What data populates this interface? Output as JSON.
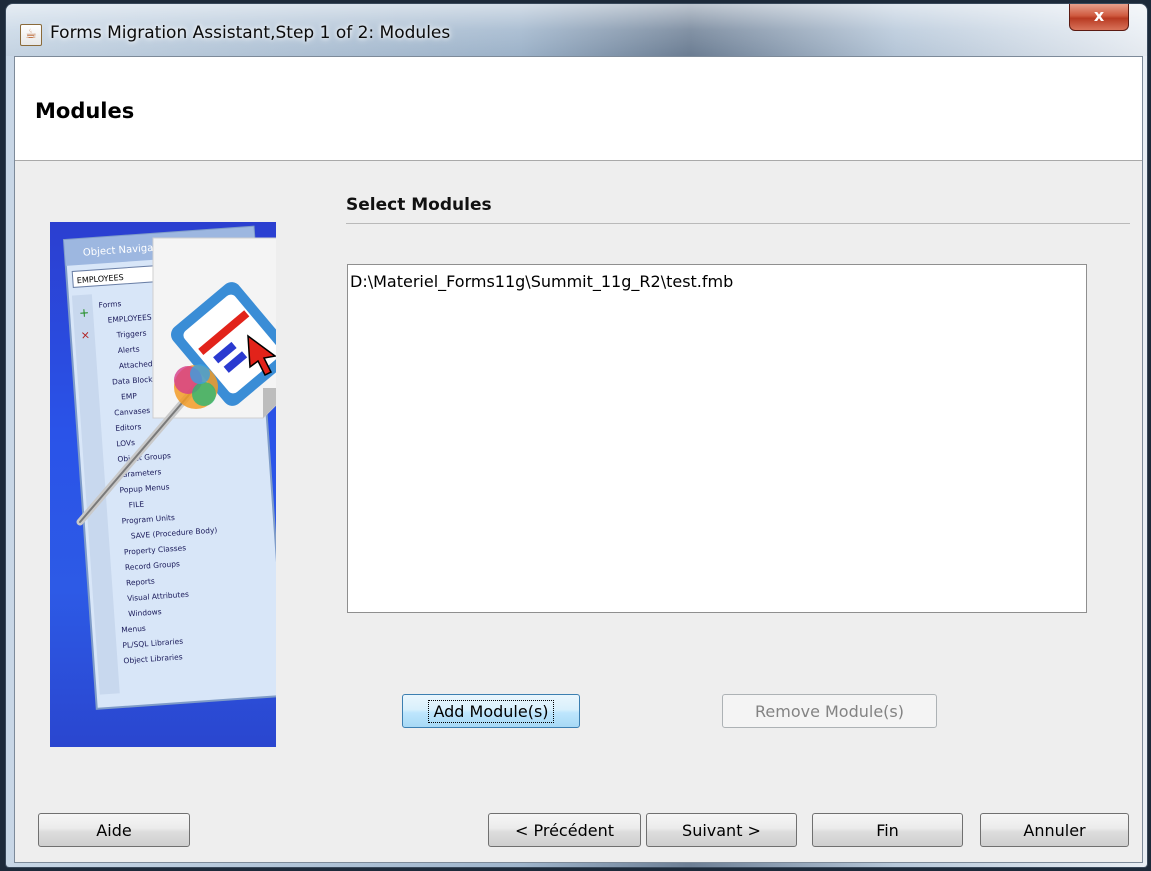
{
  "window": {
    "title": "Forms Migration Assistant,Step 1 of 2: Modules",
    "close_label": "x"
  },
  "header": {
    "title": "Modules"
  },
  "graphic": {
    "window_title": "Object Navigator",
    "dropdown": "EMPLOYEES",
    "tree": [
      "Forms",
      "EMPLOYEES",
      "Triggers",
      "Alerts",
      "Attached",
      "Data Blocks",
      "EMP",
      "Canvases",
      "Editors",
      "LOVs",
      "Object Groups",
      "Parameters",
      "Popup Menus",
      "FILE",
      "Program Units",
      "SAVE (Procedure Body)",
      "Property Classes",
      "Record Groups",
      "Reports",
      "Visual Attributes",
      "Windows",
      "Menus",
      "PL/SQL Libraries",
      "Object Libraries"
    ]
  },
  "select_modules": {
    "label": "Select Modules",
    "items": [
      "D:\\Materiel_Forms11g\\Summit_11g_R2\\test.fmb"
    ],
    "add_button": "Add Module(s)",
    "remove_button": "Remove Module(s)"
  },
  "footer": {
    "help": "Aide",
    "previous": "< Précédent",
    "next": "Suivant >",
    "finish": "Fin",
    "cancel": "Annuler"
  }
}
